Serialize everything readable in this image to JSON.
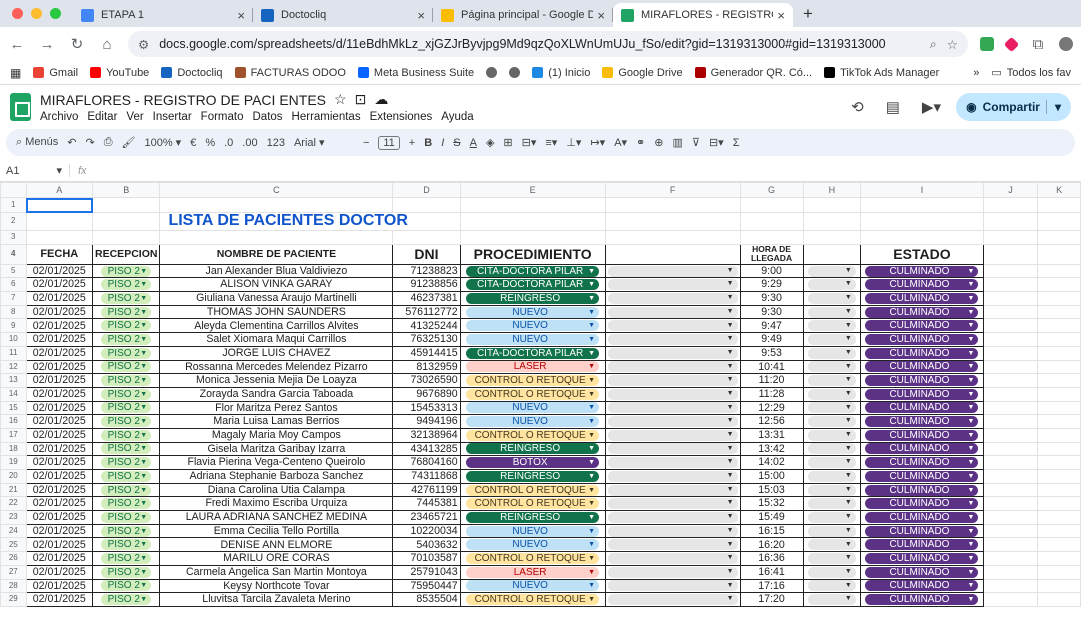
{
  "browser": {
    "tabs": [
      {
        "label": "ETAPA 1",
        "color": "#4285f4",
        "active": false
      },
      {
        "label": "Doctocliq",
        "color": "#1565c0",
        "active": false
      },
      {
        "label": "Página principal - Google Driv",
        "color": "#fbbc04",
        "active": false
      },
      {
        "label": "MIRAFLORES - REGISTRO DE",
        "color": "#1fa463",
        "active": true
      }
    ],
    "url": "docs.google.com/spreadsheets/d/11eBdhMkLz_xjGZJrByvjpg9Md9qzQoXLWnUmUJu_fSo/edit?gid=1319313000#gid=1319313000",
    "bookmarks": [
      "Gmail",
      "YouTube",
      "Doctocliq",
      "FACTURAS ODOO",
      "Meta Business Suite",
      "",
      "",
      "(1) Inicio",
      "Google Drive",
      "Generador QR. Có...",
      "TikTok Ads Manager"
    ],
    "bookmarks_more": "»",
    "bookmarks_folder": "Todos los fav"
  },
  "doc": {
    "title": "MIRAFLORES - REGISTRO DE PACI  ENTES",
    "menus": [
      "Archivo",
      "Editar",
      "Ver",
      "Insertar",
      "Formato",
      "Datos",
      "Herramientas",
      "Extensiones",
      "Ayuda"
    ],
    "share": "Compartir"
  },
  "toolbar": {
    "menus": "Menús",
    "zoom": "100%",
    "currency": "€",
    "percent": "%",
    "dec_down": ".0",
    "dec_up": ".00",
    "num": "123",
    "font": "Arial",
    "size": "11"
  },
  "formula": {
    "cell": "A1",
    "fx": "fx"
  },
  "columns": [
    "A",
    "B",
    "C",
    "D",
    "E",
    "F",
    "G",
    "H",
    "I",
    "J",
    "K"
  ],
  "sheet": {
    "title": "LISTA DE PACIENTES DOCTOR",
    "headers": {
      "fecha": "FECHA",
      "recepcion": "RECEPCION",
      "nombre": "NOMBRE DE PACIENTE",
      "dni": "DNI",
      "proc": "PROCEDIMIENTO",
      "hora": "HORA DE LLEGADA",
      "estado": "ESTADO"
    },
    "rows": [
      {
        "n": "5",
        "fecha": "02/01/2025",
        "rec": "PISO 2",
        "nombre": "Jan Alexander Blua Valdiviezo",
        "dni": "71238823",
        "proc": "CITA-DOCTORA PILAR",
        "hora": "9:00",
        "estado": "CULMINADO"
      },
      {
        "n": "6",
        "fecha": "02/01/2025",
        "rec": "PISO 2",
        "nombre": "ALISON VINKA GARAY",
        "dni": "91238856",
        "proc": "CITA-DOCTORA PILAR",
        "hora": "9:29",
        "estado": "CULMINADO"
      },
      {
        "n": "7",
        "fecha": "02/01/2025",
        "rec": "PISO 2",
        "nombre": "Giuliana Vanessa Araujo Martinelli",
        "dni": "46237381",
        "proc": "REINGRESO",
        "hora": "9:30",
        "estado": "CULMINADO"
      },
      {
        "n": "8",
        "fecha": "02/01/2025",
        "rec": "PISO 2",
        "nombre": "THOMAS JOHN SAUNDERS",
        "dni": "576112772",
        "proc": "NUEVO",
        "hora": "9:30",
        "estado": "CULMINADO"
      },
      {
        "n": "9",
        "fecha": "02/01/2025",
        "rec": "PISO 2",
        "nombre": "Aleyda Clementina Carrillos Alvites",
        "dni": "41325244",
        "proc": "NUEVO",
        "hora": "9:47",
        "estado": "CULMINADO"
      },
      {
        "n": "10",
        "fecha": "02/01/2025",
        "rec": "PISO 2",
        "nombre": "Salet Xiomara Maqui Carrillos",
        "dni": "76325130",
        "proc": "NUEVO",
        "hora": "9:49",
        "estado": "CULMINADO"
      },
      {
        "n": "11",
        "fecha": "02/01/2025",
        "rec": "PISO 2",
        "nombre": "JORGE LUIS CHAVEZ",
        "dni": "45914415",
        "proc": "CITA-DOCTORA PILAR",
        "hora": "9:53",
        "estado": "CULMINADO"
      },
      {
        "n": "12",
        "fecha": "02/01/2025",
        "rec": "PISO 2",
        "nombre": "Rossanna Mercedes Melendez Pizarro",
        "dni": "8132959",
        "proc": "LASER",
        "hora": "10:41",
        "estado": "CULMINADO"
      },
      {
        "n": "13",
        "fecha": "02/01/2025",
        "rec": "PISO 2",
        "nombre": "Monica Jessenia Mejia De Loayza",
        "dni": "73026590",
        "proc": "CONTROL O RETOQUE",
        "hora": "11:20",
        "estado": "CULMINADO"
      },
      {
        "n": "14",
        "fecha": "02/01/2025",
        "rec": "PISO 2",
        "nombre": "Zorayda Sandra Garcia Taboada",
        "dni": "9676890",
        "proc": "CONTROL O RETOQUE",
        "hora": "11:28",
        "estado": "CULMINADO"
      },
      {
        "n": "15",
        "fecha": "02/01/2025",
        "rec": "PISO 2",
        "nombre": "Flor Maritza Perez Santos",
        "dni": "15453313",
        "proc": "NUEVO",
        "hora": "12:29",
        "estado": "CULMINADO"
      },
      {
        "n": "16",
        "fecha": "02/01/2025",
        "rec": "PISO 2",
        "nombre": "Maria Luisa Lamas Berrios",
        "dni": "9494196",
        "proc": "NUEVO",
        "hora": "12:56",
        "estado": "CULMINADO"
      },
      {
        "n": "17",
        "fecha": "02/01/2025",
        "rec": "PISO 2",
        "nombre": "Magaly Maria Moy Campos",
        "dni": "32138964",
        "proc": "CONTROL O RETOQUE",
        "hora": "13:31",
        "estado": "CULMINADO"
      },
      {
        "n": "18",
        "fecha": "02/01/2025",
        "rec": "PISO 2",
        "nombre": "Gisela Maritza Garibay Izarra",
        "dni": "43413285",
        "proc": "REINGRESO",
        "hora": "13:42",
        "estado": "CULMINADO"
      },
      {
        "n": "19",
        "fecha": "02/01/2025",
        "rec": "PISO 2",
        "nombre": "Flavia Pierina Vega-Centeno Queirolo",
        "dni": "76804160",
        "proc": "BOTOX",
        "hora": "14:02",
        "estado": "CULMINADO"
      },
      {
        "n": "20",
        "fecha": "02/01/2025",
        "rec": "PISO 2",
        "nombre": "Adriana Stephanie Barboza Sanchez",
        "dni": "74311868",
        "proc": "REINGRESO",
        "hora": "15:00",
        "estado": "CULMINADO"
      },
      {
        "n": "21",
        "fecha": "02/01/2025",
        "rec": "PISO 2",
        "nombre": "Diana Carolina Utia Calampa",
        "dni": "42761199",
        "proc": "CONTROL O RETOQUE",
        "hora": "15:03",
        "estado": "CULMINADO"
      },
      {
        "n": "22",
        "fecha": "02/01/2025",
        "rec": "PISO 2",
        "nombre": "Fredi Maximo Escriba Urquiza",
        "dni": "7445381",
        "proc": "CONTROL O RETOQUE",
        "hora": "15:32",
        "estado": "CULMINADO"
      },
      {
        "n": "23",
        "fecha": "02/01/2025",
        "rec": "PISO 2",
        "nombre": "LAURA ADRIANA SANCHEZ MEDINA",
        "dni": "23465721",
        "proc": "REINGRESO",
        "hora": "15:49",
        "estado": "CULMINADO"
      },
      {
        "n": "24",
        "fecha": "02/01/2025",
        "rec": "PISO 2",
        "nombre": "Emma Cecilia Tello Portilla",
        "dni": "10220034",
        "proc": "NUEVO",
        "hora": "16:15",
        "estado": "CULMINADO"
      },
      {
        "n": "25",
        "fecha": "02/01/2025",
        "rec": "PISO 2",
        "nombre": "DENISE ANN ELMORE",
        "dni": "5403632",
        "proc": "NUEVO",
        "hora": "16:20",
        "estado": "CULMINADO"
      },
      {
        "n": "26",
        "fecha": "02/01/2025",
        "rec": "PISO 2",
        "nombre": "MARILU ORE CORAS",
        "dni": "70103587",
        "proc": "CONTROL O RETOQUE",
        "hora": "16:36",
        "estado": "CULMINADO"
      },
      {
        "n": "27",
        "fecha": "02/01/2025",
        "rec": "PISO 2",
        "nombre": "Carmela Angelica San Martin Montoya",
        "dni": "25791043",
        "proc": "LASER",
        "hora": "16:41",
        "estado": "CULMINADO"
      },
      {
        "n": "28",
        "fecha": "02/01/2025",
        "rec": "PISO 2",
        "nombre": "Keysy Northcote Tovar",
        "dni": "75950447",
        "proc": "NUEVO",
        "hora": "17:16",
        "estado": "CULMINADO"
      },
      {
        "n": "29",
        "fecha": "02/01/2025",
        "rec": "PISO 2",
        "nombre": "Lluvitsa Tarcila Zavaleta Merino",
        "dni": "8535504",
        "proc": "CONTROL O RETOQUE",
        "hora": "17:20",
        "estado": "CULMINADO"
      }
    ],
    "proc_colors": {
      "CITA-DOCTORA PILAR": {
        "bg": "#11734b",
        "fg": "#ffffff"
      },
      "REINGRESO": {
        "bg": "#11734b",
        "fg": "#ffffff"
      },
      "NUEVO": {
        "bg": "#bfe1f6",
        "fg": "#0a53a8"
      },
      "LASER": {
        "bg": "#ffcfc9",
        "fg": "#b10202"
      },
      "CONTROL O RETOQUE": {
        "bg": "#ffe5a0",
        "fg": "#473821"
      },
      "BOTOX": {
        "bg": "#5b3286",
        "fg": "#ffffff"
      }
    }
  }
}
